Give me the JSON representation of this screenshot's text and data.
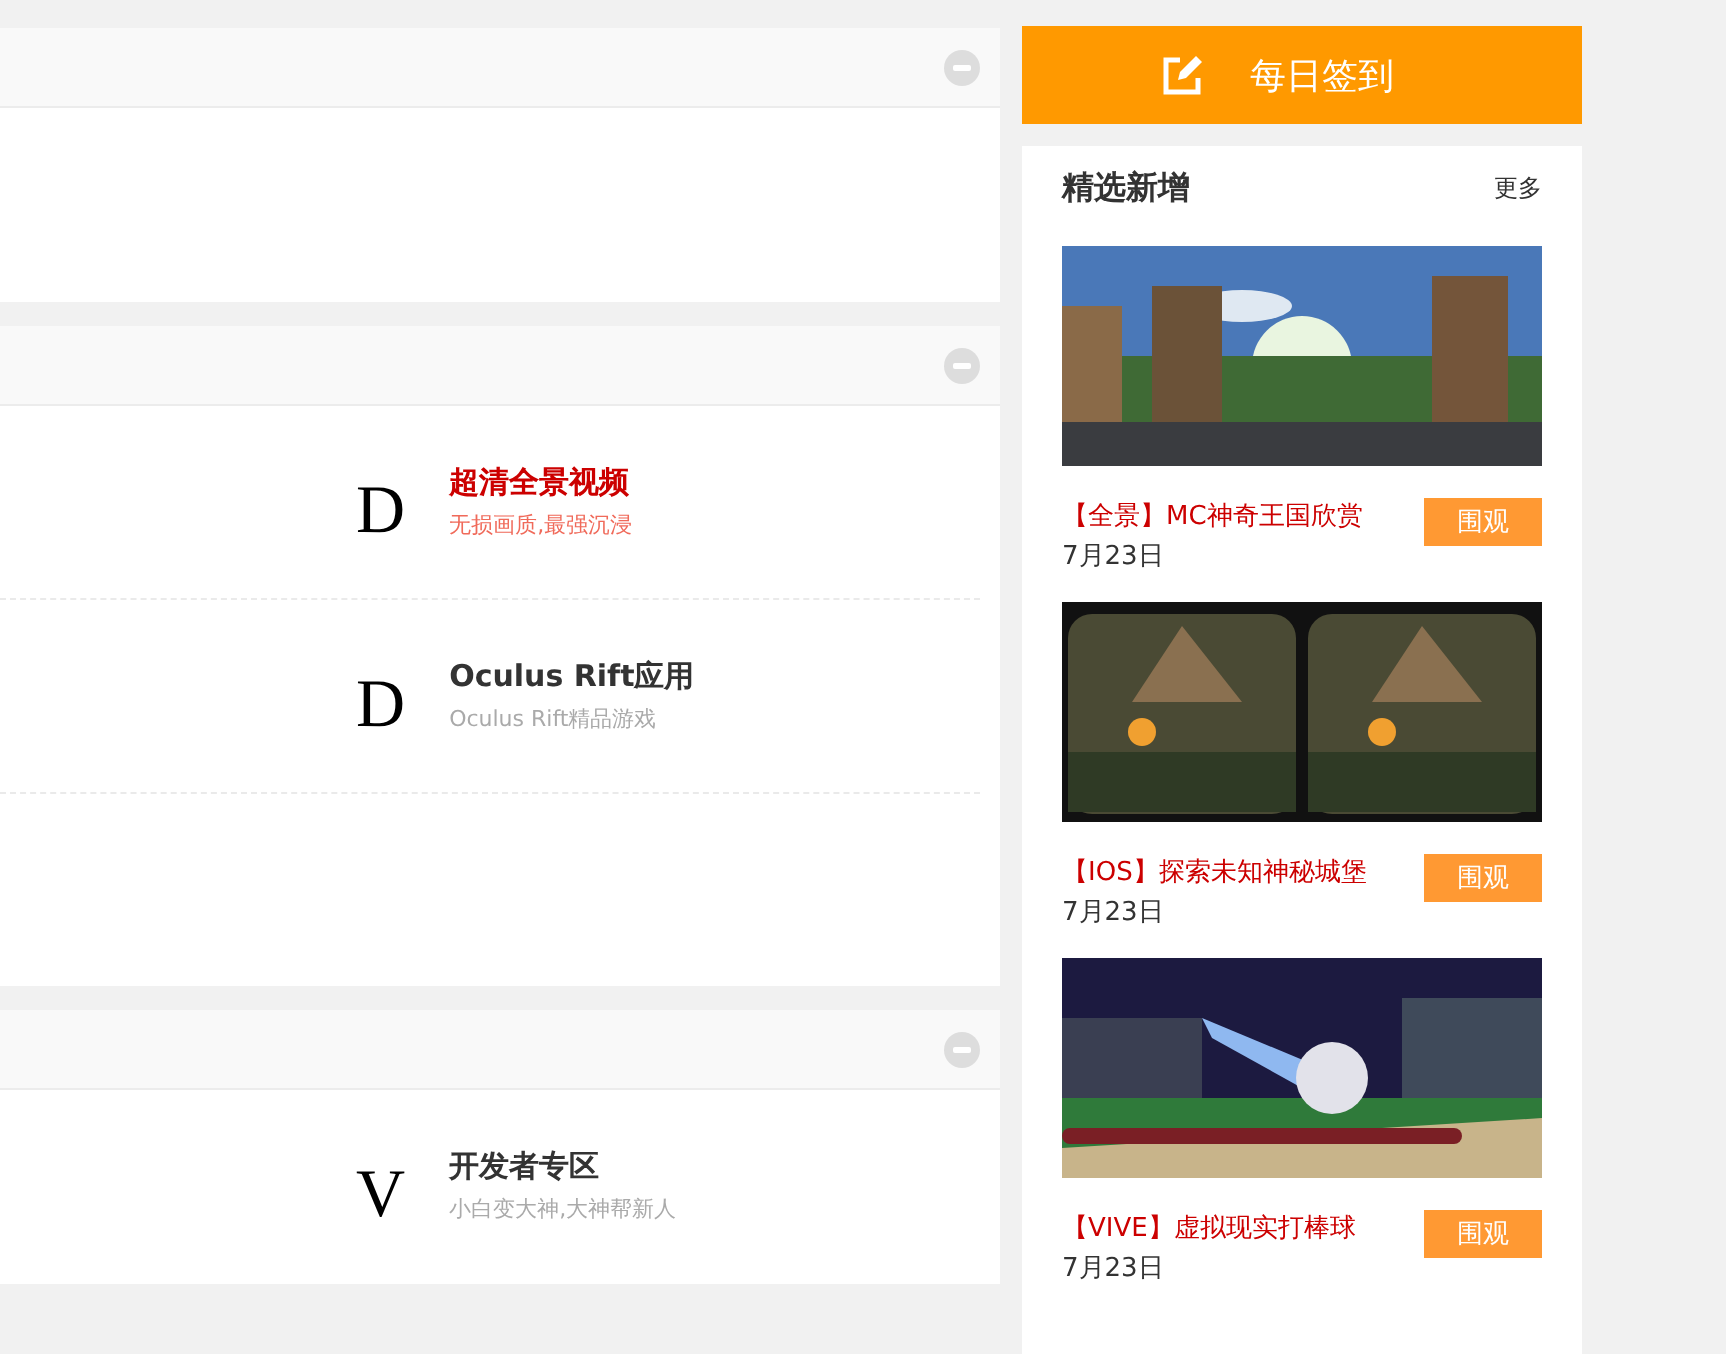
{
  "sections": [
    {
      "collapsed": false
    },
    {
      "collapsed": false,
      "rows": [
        {
          "kind": "forum",
          "letter": "D",
          "title": "超清全景视频",
          "highlighted": true,
          "description": "无损画质,最强沉浸"
        },
        {
          "kind": "forum",
          "letter": "D",
          "title": "Oculus Rift应用",
          "highlighted": false,
          "description": "Oculus Rift精品游戏"
        },
        {
          "kind": "empty"
        }
      ]
    },
    {
      "collapsed": false,
      "rows": [
        {
          "kind": "forum",
          "letter": "V",
          "title": "开发者专区",
          "highlighted": false,
          "description": "小白变大神,大神帮新人"
        }
      ]
    }
  ],
  "checkin": {
    "label": "每日签到"
  },
  "featured": {
    "title": "精选新增",
    "more": "更多",
    "items": [
      {
        "kind": "picture",
        "title": "【全景】MC神奇王国欣赏",
        "date": "7月23日",
        "button": "围观"
      },
      {
        "kind": "picture",
        "title": "【IOS】探索未知神秘城堡",
        "date": "7月23日",
        "button": "围观"
      },
      {
        "kind": "picture",
        "title": "【VIVE】虚拟现实打棒球",
        "date": "7月23日",
        "button": "围观"
      }
    ]
  }
}
